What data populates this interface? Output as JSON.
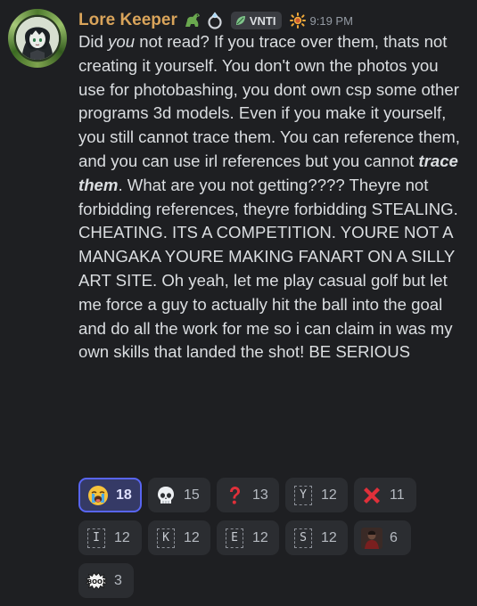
{
  "message": {
    "username": "Lore Keeper",
    "tag": "VNTI",
    "timestamp": "9:19 PM",
    "icons": {
      "avatar": "avatar-girl-icon",
      "badge1": "dinosaur-icon",
      "badge2": "ring-icon",
      "tag_icon": "leaf-icon",
      "role": "sun-icon"
    },
    "text": {
      "p1": "Did ",
      "p1_em": "you",
      "p2": " not read? If you trace over them, thats not creating it yourself. You don't own the photos you use for photobashing, you dont own csp some other programs 3d models. Even if you make it yourself, you still cannot trace them. You can reference them, and you can use irl references but you cannot ",
      "p2_strong": "trace them",
      "p3": ". What are you not getting???? Theyre not forbidding references, theyre forbidding STEALING. CHEATING. ITS A COMPETITION. YOURE NOT A MANGAKA YOURE MAKING FANART ON A SILLY ART SITE. Oh yeah, let me play casual golf but let me force a guy to actually hit the ball into the goal and do all the work for me so i can claim in was my own skills that landed the shot! BE SERIOUS"
    }
  },
  "reactions": [
    {
      "icon": "loudly-crying-face-icon",
      "count": "18",
      "active": true
    },
    {
      "icon": "skull-icon",
      "count": "15"
    },
    {
      "icon": "red-question-mark-icon",
      "count": "13"
    },
    {
      "icon": "letter-y-icon",
      "letter": "Y",
      "count": "12"
    },
    {
      "icon": "cross-mark-icon",
      "count": "11"
    },
    {
      "icon": "letter-i-icon",
      "letter": "I",
      "count": "12"
    },
    {
      "icon": "letter-k-icon",
      "letter": "K",
      "count": "12"
    },
    {
      "icon": "letter-e-icon",
      "letter": "E",
      "count": "12"
    },
    {
      "icon": "letter-s-icon",
      "letter": "S",
      "count": "12"
    },
    {
      "icon": "person-portrait-icon",
      "count": "6"
    },
    {
      "icon": "boo-sticker-icon",
      "label": "BOO!",
      "count": "3"
    }
  ],
  "colors": {
    "background": "#1e1f22",
    "username": "#d9a45b",
    "text": "#dbdee1",
    "reaction_bg": "#2b2d31",
    "reaction_active_bg": "#353a66",
    "reaction_active_border": "#5865f2"
  }
}
